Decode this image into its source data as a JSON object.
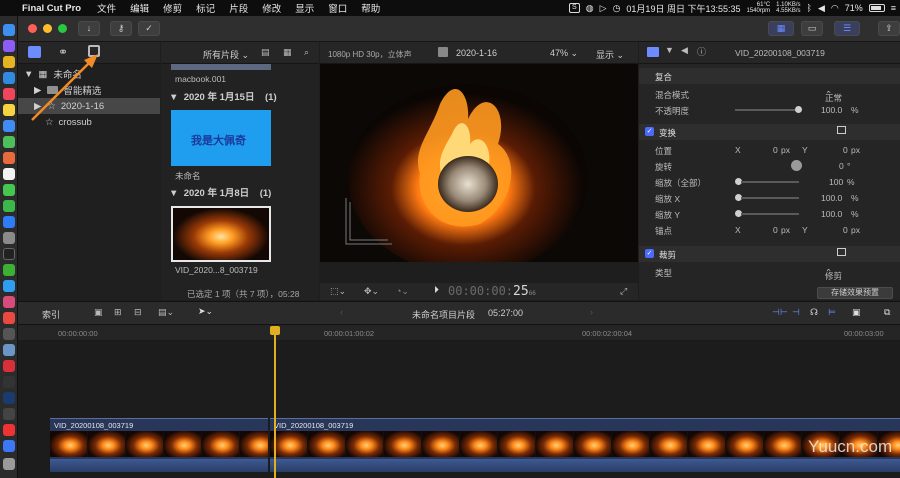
{
  "menubar": {
    "app_name": "Final Cut Pro",
    "menus": [
      "文件",
      "编辑",
      "修剪",
      "标记",
      "片段",
      "修改",
      "显示",
      "窗口",
      "帮助"
    ],
    "clock": "01月19日 周日 下午13:55:35",
    "cpu_temp": "61°C",
    "cpu_fan": "1540rpm",
    "net_up": "1.10KB/s",
    "net_down": "4.55KB/s",
    "battery": "71%"
  },
  "library": {
    "root_label": "未命名",
    "items": [
      {
        "label": "智能精选"
      },
      {
        "label": "2020-1-16"
      },
      {
        "label": "crossub"
      }
    ]
  },
  "browser": {
    "filter_label": "所有片段",
    "top_clip_caption": "macbook.001",
    "groups": [
      {
        "date": "2020 年 1月15日",
        "count": "(1)",
        "clip_caption": "未命名",
        "thumb_text": "我是大佩奇"
      },
      {
        "date": "2020 年 1月8日",
        "count": "(1)",
        "clip_caption": "VID_2020...8_003719"
      }
    ],
    "status": "已选定 1 项（共 7 项），05:28"
  },
  "viewer": {
    "format": "1080p HD 30p，立体声",
    "clip_name": "2020-1-16",
    "zoom": "47%",
    "view_label": "显示",
    "timecode": "00:00:00:25",
    "timecode_main": "00:00:00:",
    "timecode_frames": "25",
    "timecode_sub": "66"
  },
  "inspector": {
    "clip_name": "VID_20200108_003719",
    "sections": {
      "composite": "复合",
      "transform": "变换",
      "crop": "裁剪"
    },
    "rows": {
      "blend_mode": {
        "label": "混合模式",
        "value": "正常"
      },
      "opacity": {
        "label": "不透明度",
        "value": "100.0",
        "unit": "%"
      },
      "position": {
        "label": "位置",
        "x": "0",
        "y": "0",
        "unit": "px"
      },
      "rotation": {
        "label": "旋转",
        "value": "0",
        "unit": "°"
      },
      "scale_all": {
        "label": "缩放（全部）",
        "value": "100",
        "unit": "%"
      },
      "scale_x": {
        "label": "缩放 X",
        "value": "100.0",
        "unit": "%"
      },
      "scale_y": {
        "label": "缩放 Y",
        "value": "100.0",
        "unit": "%"
      },
      "anchor": {
        "label": "锚点",
        "x": "0",
        "y": "0",
        "unit": "px"
      },
      "crop_type": {
        "label": "类型",
        "value": "修剪"
      }
    },
    "axis_x": "X",
    "axis_y": "Y",
    "save_preset": "存储效果预置"
  },
  "timeline": {
    "index_label": "索引",
    "project_name": "未命名项目片段",
    "duration": "05:27:00",
    "ruler": [
      "00:00:00:00",
      "00:00:01:00:02",
      "00:00:02:00:04",
      "00:00:03:00"
    ],
    "clips": [
      {
        "name": "VID_20200108_003719"
      },
      {
        "name": "VID_20200108_003719"
      }
    ]
  },
  "watermark": "Yuucn.com"
}
